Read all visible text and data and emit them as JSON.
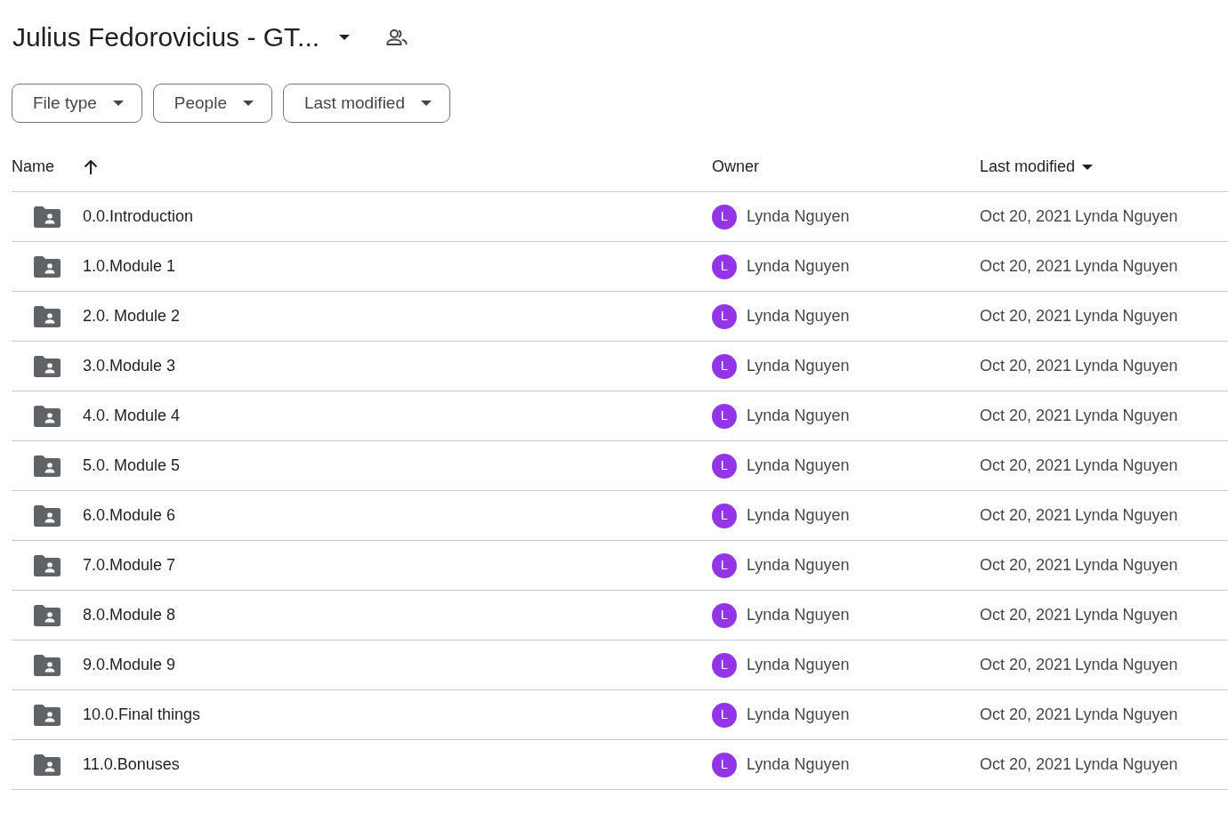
{
  "title": "Julius Fedorovicius - GT...",
  "filters": [
    {
      "label": "File type"
    },
    {
      "label": "People"
    },
    {
      "label": "Last modified"
    }
  ],
  "table": {
    "columns": [
      {
        "label": "Name",
        "kind": "sort"
      },
      {
        "label": "Owner",
        "kind": "plain"
      },
      {
        "label": "Last modified",
        "kind": "menu"
      }
    ],
    "rows": [
      {
        "name": "0.0.Introduction",
        "owner_initial": "L",
        "owner": "Lynda Nguyen",
        "date": "Oct 20, 2021",
        "modified_by": "Lynda Nguyen"
      },
      {
        "name": "1.0.Module 1",
        "owner_initial": "L",
        "owner": "Lynda Nguyen",
        "date": "Oct 20, 2021",
        "modified_by": "Lynda Nguyen"
      },
      {
        "name": "2.0. Module 2",
        "owner_initial": "L",
        "owner": "Lynda Nguyen",
        "date": "Oct 20, 2021",
        "modified_by": "Lynda Nguyen"
      },
      {
        "name": "3.0.Module 3",
        "owner_initial": "L",
        "owner": "Lynda Nguyen",
        "date": "Oct 20, 2021",
        "modified_by": "Lynda Nguyen"
      },
      {
        "name": "4.0. Module 4",
        "owner_initial": "L",
        "owner": "Lynda Nguyen",
        "date": "Oct 20, 2021",
        "modified_by": "Lynda Nguyen"
      },
      {
        "name": "5.0. Module 5",
        "owner_initial": "L",
        "owner": "Lynda Nguyen",
        "date": "Oct 20, 2021",
        "modified_by": "Lynda Nguyen"
      },
      {
        "name": "6.0.Module 6",
        "owner_initial": "L",
        "owner": "Lynda Nguyen",
        "date": "Oct 20, 2021",
        "modified_by": "Lynda Nguyen"
      },
      {
        "name": "7.0.Module 7",
        "owner_initial": "L",
        "owner": "Lynda Nguyen",
        "date": "Oct 20, 2021",
        "modified_by": "Lynda Nguyen"
      },
      {
        "name": "8.0.Module 8",
        "owner_initial": "L",
        "owner": "Lynda Nguyen",
        "date": "Oct 20, 2021",
        "modified_by": "Lynda Nguyen"
      },
      {
        "name": "9.0.Module 9",
        "owner_initial": "L",
        "owner": "Lynda Nguyen",
        "date": "Oct 20, 2021",
        "modified_by": "Lynda Nguyen"
      },
      {
        "name": "10.0.Final things",
        "owner_initial": "L",
        "owner": "Lynda Nguyen",
        "date": "Oct 20, 2021",
        "modified_by": "Lynda Nguyen"
      },
      {
        "name": "11.0.Bonuses",
        "owner_initial": "L",
        "owner": "Lynda Nguyen",
        "date": "Oct 20, 2021",
        "modified_by": "Lynda Nguyen"
      }
    ]
  }
}
